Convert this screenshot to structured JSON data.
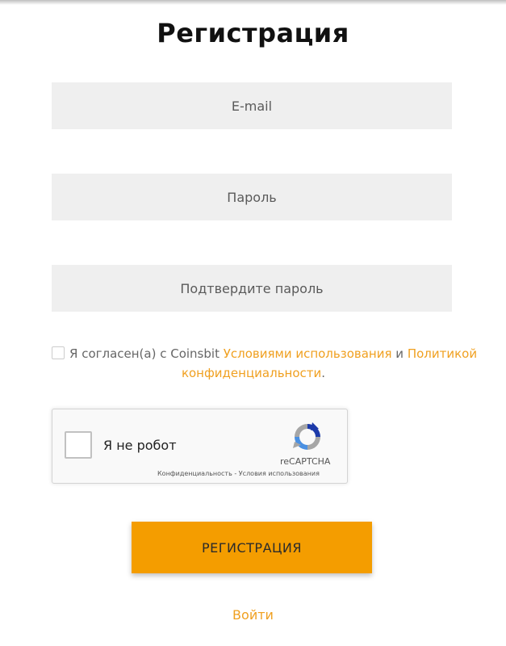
{
  "page": {
    "title": "Регистрация"
  },
  "form": {
    "email_placeholder": "E-mail",
    "password_placeholder": "Пароль",
    "confirm_placeholder": "Подтвердите пароль",
    "agree_prefix": "Я согласен(а) с Coinsbit",
    "terms_link": "Условиями использования",
    "agree_and": "и",
    "privacy_link_1": "Политикой",
    "privacy_link_2": "конфиденциальности",
    "agree_suffix": ".",
    "submit_label": "РЕГИСТРАЦИЯ",
    "login_link": "Войти"
  },
  "recaptcha": {
    "label": "Я не робот",
    "brand": "reCAPTCHA",
    "privacy": "Конфиденциальность",
    "separator": "-",
    "terms": "Условия использования",
    "icon": "recaptcha-logo-icon"
  },
  "colors": {
    "accent": "#f49d00",
    "link": "#f0a020",
    "field_bg": "#efefef"
  }
}
